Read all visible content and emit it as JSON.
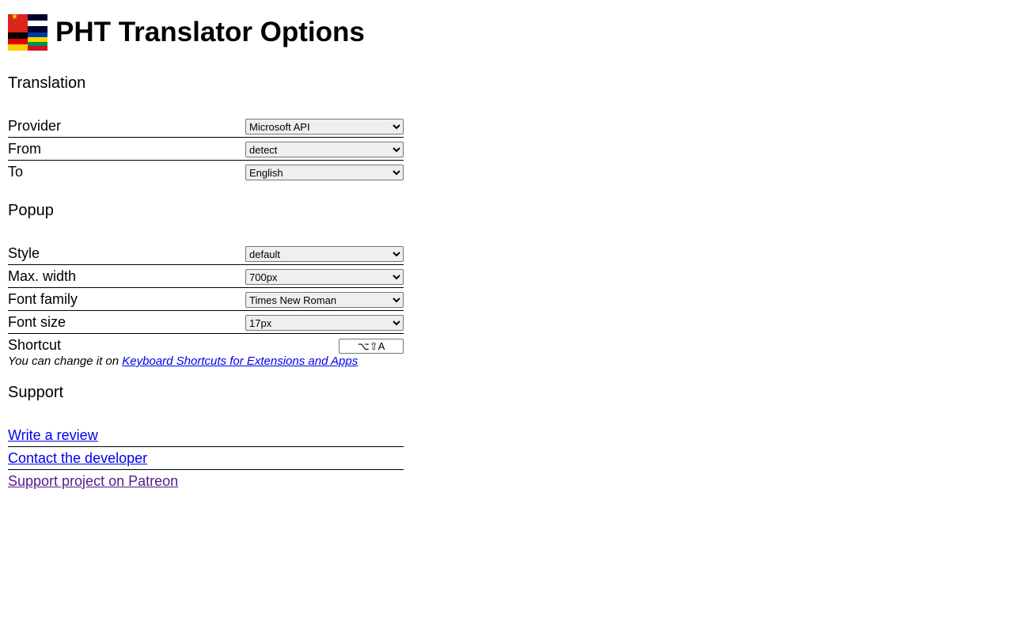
{
  "header": {
    "title": "PHT Translator Options"
  },
  "sections": {
    "translation": {
      "title": "Translation",
      "provider_label": "Provider",
      "provider_value": "Microsoft API",
      "from_label": "From",
      "from_value": "detect",
      "to_label": "To",
      "to_value": "English"
    },
    "popup": {
      "title": "Popup",
      "style_label": "Style",
      "style_value": "default",
      "maxwidth_label": "Max. width",
      "maxwidth_value": "700px",
      "fontfamily_label": "Font family",
      "fontfamily_value": "Times New Roman",
      "fontsize_label": "Font size",
      "fontsize_value": "17px",
      "shortcut_label": "Shortcut",
      "shortcut_value": "⌥⇧A",
      "hint_prefix": "You can change it on ",
      "hint_link": "Keyboard Shortcuts for Extensions and Apps"
    },
    "support": {
      "title": "Support",
      "review": "Write a review",
      "contact": "Contact the developer",
      "patreon": "Support project on Patreon"
    }
  }
}
